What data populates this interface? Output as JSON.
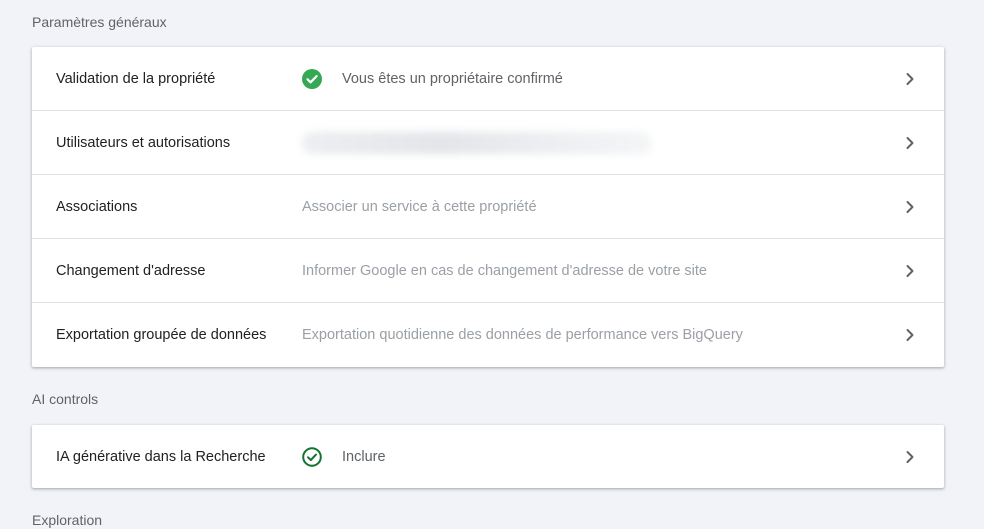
{
  "sections": {
    "general": {
      "title": "Paramètres généraux",
      "rows": [
        {
          "label": "Validation de la propriété",
          "value": "Vous êtes un propriétaire confirmé",
          "icon": "check-circle-filled-icon"
        },
        {
          "label": "Utilisateurs et autorisations",
          "value": "",
          "icon": "chevron-right-icon"
        },
        {
          "label": "Associations",
          "value": "Associer un service à cette propriété"
        },
        {
          "label": "Changement d'adresse",
          "value": "Informer Google en cas de changement d'adresse de votre site"
        },
        {
          "label": "Exportation groupée de données",
          "value": "Exportation quotidienne des données de performance vers BigQuery"
        }
      ]
    },
    "ai": {
      "title": "AI controls",
      "rows": [
        {
          "label": "IA générative dans la Recherche",
          "value": "Inclure",
          "icon": "check-circle-outline-icon"
        }
      ]
    },
    "exploration": {
      "title": "Exploration"
    }
  },
  "colors": {
    "success": "#34a853",
    "success_outline": "#137333",
    "background": "#f1f3f8"
  }
}
